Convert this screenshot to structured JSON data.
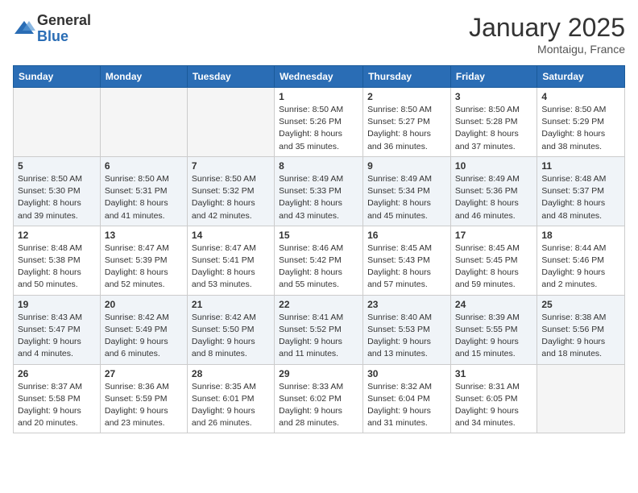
{
  "logo": {
    "general": "General",
    "blue": "Blue"
  },
  "title": "January 2025",
  "location": "Montaigu, France",
  "days_of_week": [
    "Sunday",
    "Monday",
    "Tuesday",
    "Wednesday",
    "Thursday",
    "Friday",
    "Saturday"
  ],
  "weeks": [
    [
      {
        "day": "",
        "content": ""
      },
      {
        "day": "",
        "content": ""
      },
      {
        "day": "",
        "content": ""
      },
      {
        "day": "1",
        "content": "Sunrise: 8:50 AM\nSunset: 5:26 PM\nDaylight: 8 hours\nand 35 minutes."
      },
      {
        "day": "2",
        "content": "Sunrise: 8:50 AM\nSunset: 5:27 PM\nDaylight: 8 hours\nand 36 minutes."
      },
      {
        "day": "3",
        "content": "Sunrise: 8:50 AM\nSunset: 5:28 PM\nDaylight: 8 hours\nand 37 minutes."
      },
      {
        "day": "4",
        "content": "Sunrise: 8:50 AM\nSunset: 5:29 PM\nDaylight: 8 hours\nand 38 minutes."
      }
    ],
    [
      {
        "day": "5",
        "content": "Sunrise: 8:50 AM\nSunset: 5:30 PM\nDaylight: 8 hours\nand 39 minutes."
      },
      {
        "day": "6",
        "content": "Sunrise: 8:50 AM\nSunset: 5:31 PM\nDaylight: 8 hours\nand 41 minutes."
      },
      {
        "day": "7",
        "content": "Sunrise: 8:50 AM\nSunset: 5:32 PM\nDaylight: 8 hours\nand 42 minutes."
      },
      {
        "day": "8",
        "content": "Sunrise: 8:49 AM\nSunset: 5:33 PM\nDaylight: 8 hours\nand 43 minutes."
      },
      {
        "day": "9",
        "content": "Sunrise: 8:49 AM\nSunset: 5:34 PM\nDaylight: 8 hours\nand 45 minutes."
      },
      {
        "day": "10",
        "content": "Sunrise: 8:49 AM\nSunset: 5:36 PM\nDaylight: 8 hours\nand 46 minutes."
      },
      {
        "day": "11",
        "content": "Sunrise: 8:48 AM\nSunset: 5:37 PM\nDaylight: 8 hours\nand 48 minutes."
      }
    ],
    [
      {
        "day": "12",
        "content": "Sunrise: 8:48 AM\nSunset: 5:38 PM\nDaylight: 8 hours\nand 50 minutes."
      },
      {
        "day": "13",
        "content": "Sunrise: 8:47 AM\nSunset: 5:39 PM\nDaylight: 8 hours\nand 52 minutes."
      },
      {
        "day": "14",
        "content": "Sunrise: 8:47 AM\nSunset: 5:41 PM\nDaylight: 8 hours\nand 53 minutes."
      },
      {
        "day": "15",
        "content": "Sunrise: 8:46 AM\nSunset: 5:42 PM\nDaylight: 8 hours\nand 55 minutes."
      },
      {
        "day": "16",
        "content": "Sunrise: 8:45 AM\nSunset: 5:43 PM\nDaylight: 8 hours\nand 57 minutes."
      },
      {
        "day": "17",
        "content": "Sunrise: 8:45 AM\nSunset: 5:45 PM\nDaylight: 8 hours\nand 59 minutes."
      },
      {
        "day": "18",
        "content": "Sunrise: 8:44 AM\nSunset: 5:46 PM\nDaylight: 9 hours\nand 2 minutes."
      }
    ],
    [
      {
        "day": "19",
        "content": "Sunrise: 8:43 AM\nSunset: 5:47 PM\nDaylight: 9 hours\nand 4 minutes."
      },
      {
        "day": "20",
        "content": "Sunrise: 8:42 AM\nSunset: 5:49 PM\nDaylight: 9 hours\nand 6 minutes."
      },
      {
        "day": "21",
        "content": "Sunrise: 8:42 AM\nSunset: 5:50 PM\nDaylight: 9 hours\nand 8 minutes."
      },
      {
        "day": "22",
        "content": "Sunrise: 8:41 AM\nSunset: 5:52 PM\nDaylight: 9 hours\nand 11 minutes."
      },
      {
        "day": "23",
        "content": "Sunrise: 8:40 AM\nSunset: 5:53 PM\nDaylight: 9 hours\nand 13 minutes."
      },
      {
        "day": "24",
        "content": "Sunrise: 8:39 AM\nSunset: 5:55 PM\nDaylight: 9 hours\nand 15 minutes."
      },
      {
        "day": "25",
        "content": "Sunrise: 8:38 AM\nSunset: 5:56 PM\nDaylight: 9 hours\nand 18 minutes."
      }
    ],
    [
      {
        "day": "26",
        "content": "Sunrise: 8:37 AM\nSunset: 5:58 PM\nDaylight: 9 hours\nand 20 minutes."
      },
      {
        "day": "27",
        "content": "Sunrise: 8:36 AM\nSunset: 5:59 PM\nDaylight: 9 hours\nand 23 minutes."
      },
      {
        "day": "28",
        "content": "Sunrise: 8:35 AM\nSunset: 6:01 PM\nDaylight: 9 hours\nand 26 minutes."
      },
      {
        "day": "29",
        "content": "Sunrise: 8:33 AM\nSunset: 6:02 PM\nDaylight: 9 hours\nand 28 minutes."
      },
      {
        "day": "30",
        "content": "Sunrise: 8:32 AM\nSunset: 6:04 PM\nDaylight: 9 hours\nand 31 minutes."
      },
      {
        "day": "31",
        "content": "Sunrise: 8:31 AM\nSunset: 6:05 PM\nDaylight: 9 hours\nand 34 minutes."
      },
      {
        "day": "",
        "content": ""
      }
    ]
  ]
}
